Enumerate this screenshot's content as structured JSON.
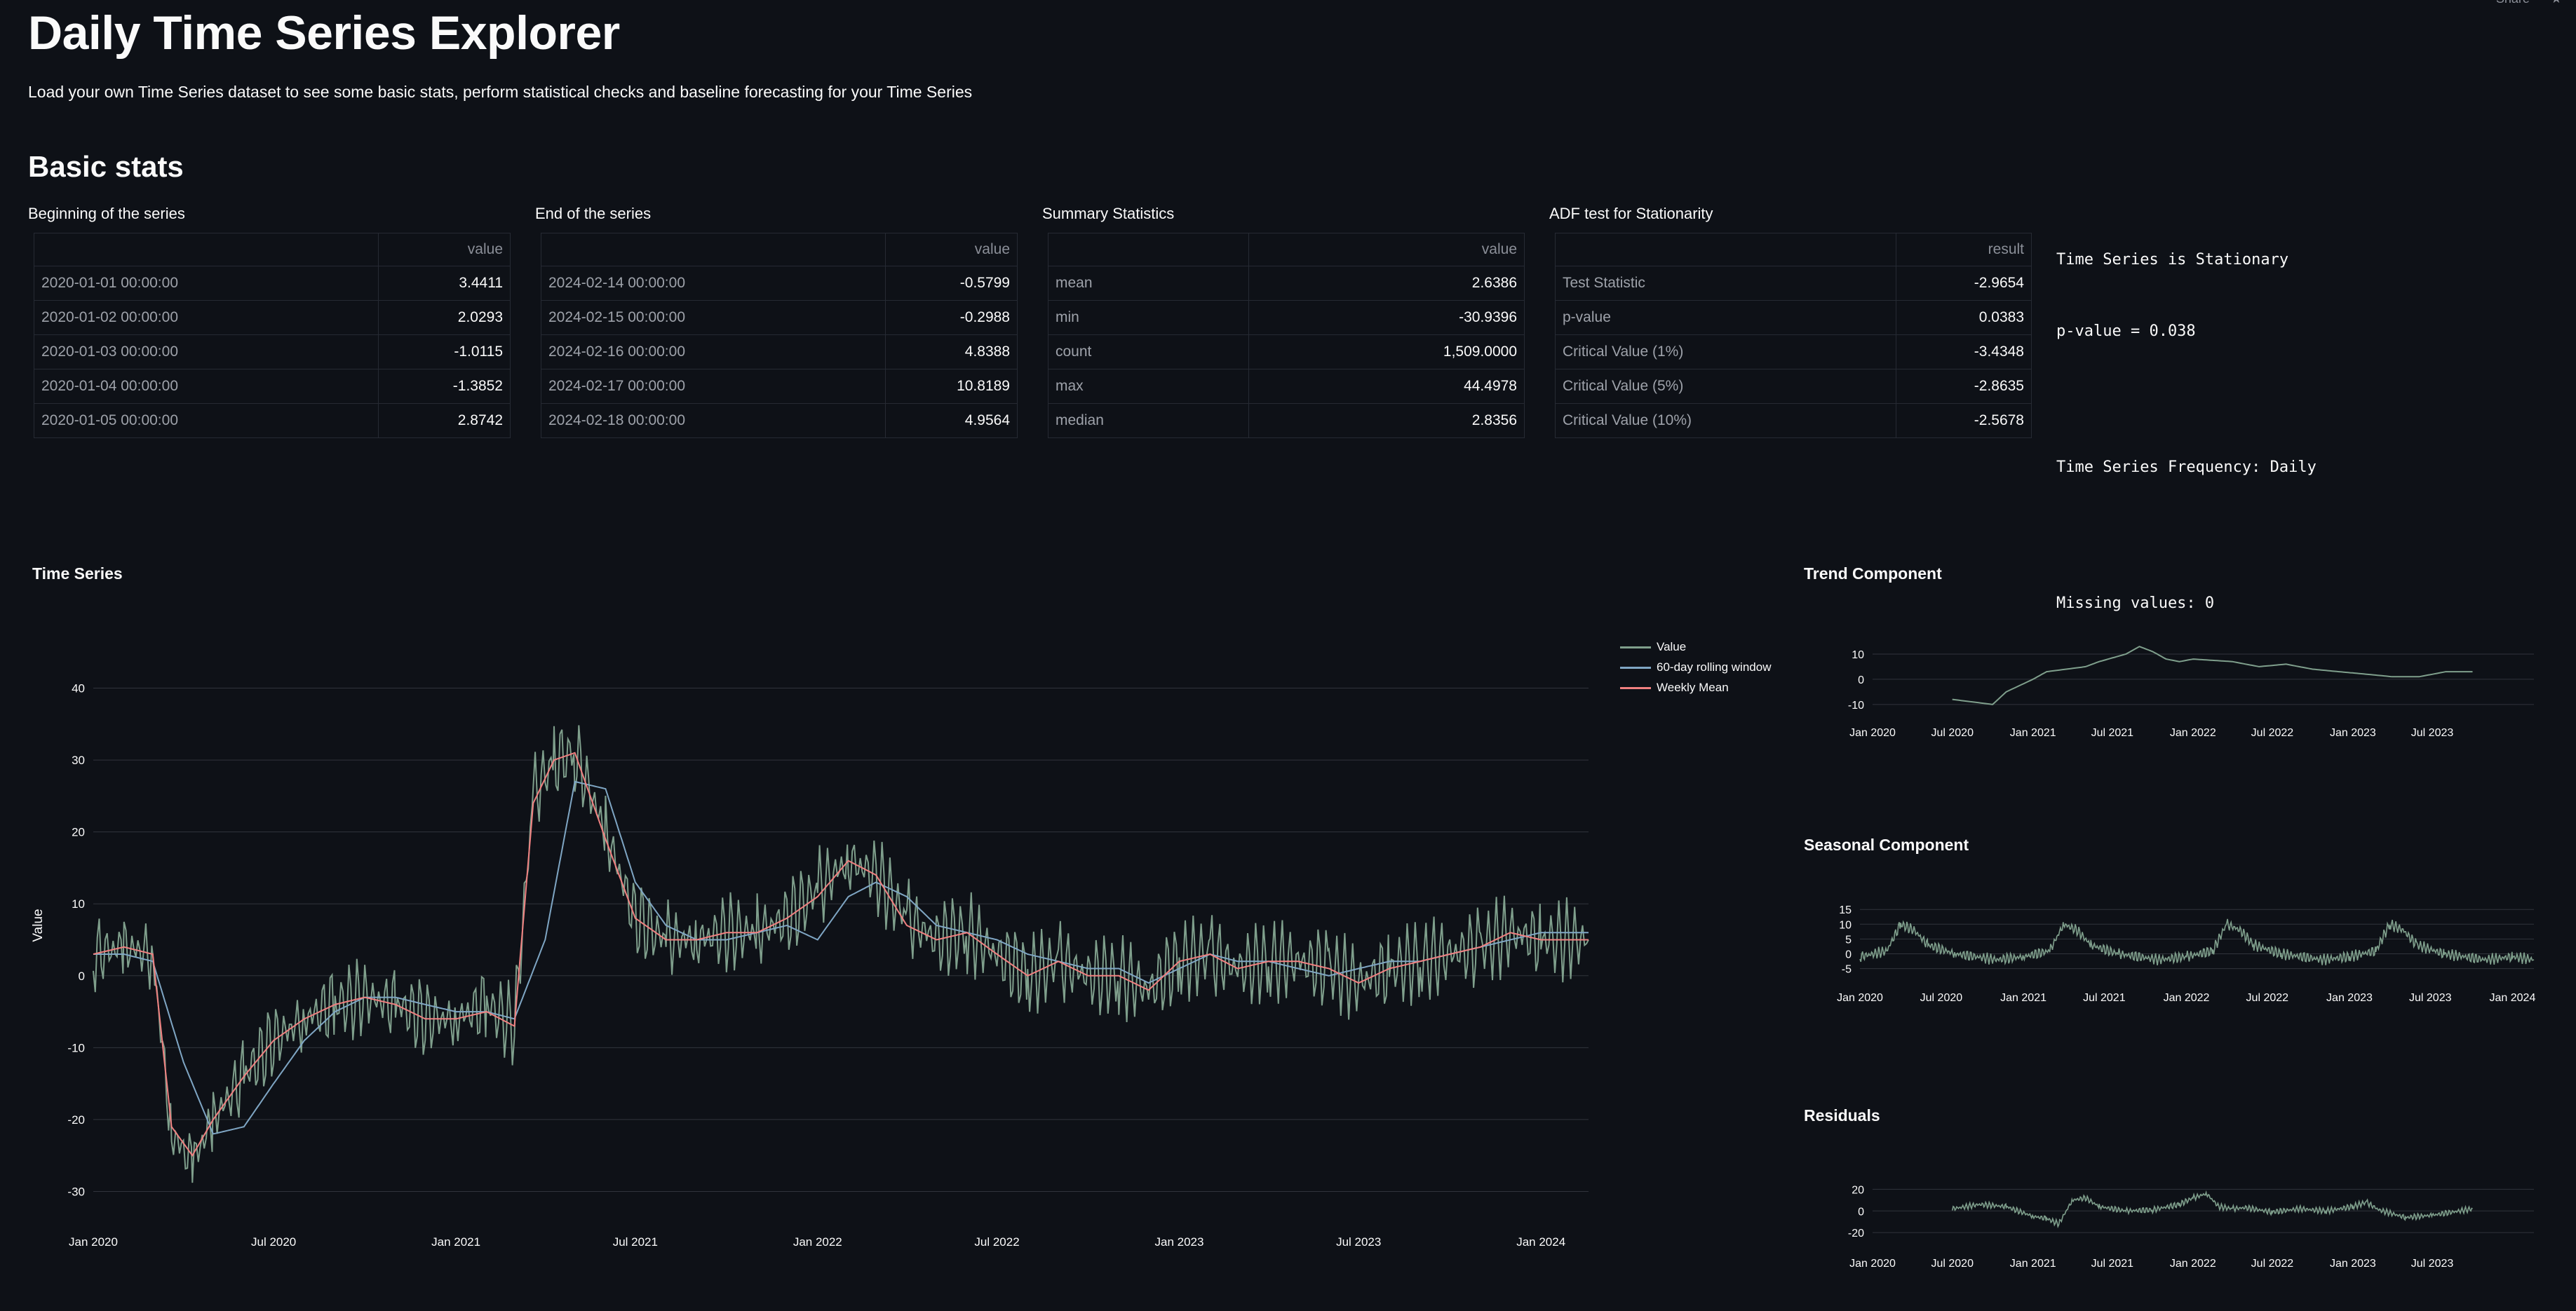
{
  "topbar": {
    "share_label": "Share",
    "star_icon": "star-icon"
  },
  "header": {
    "title": "Daily Time Series Explorer",
    "subtitle": "Load your own Time Series dataset to see some basic stats, perform statistical checks and baseline forecasting for your Time Series"
  },
  "basic_stats": {
    "heading": "Basic stats",
    "tables": [
      {
        "caption": "Beginning of the series",
        "column": "value",
        "rows": [
          [
            "2020-01-01 00:00:00",
            "3.4411"
          ],
          [
            "2020-01-02 00:00:00",
            "2.0293"
          ],
          [
            "2020-01-03 00:00:00",
            "-1.0115"
          ],
          [
            "2020-01-04 00:00:00",
            "-1.3852"
          ],
          [
            "2020-01-05 00:00:00",
            "2.8742"
          ]
        ]
      },
      {
        "caption": "End of the series",
        "column": "value",
        "rows": [
          [
            "2024-02-14 00:00:00",
            "-0.5799"
          ],
          [
            "2024-02-15 00:00:00",
            "-0.2988"
          ],
          [
            "2024-02-16 00:00:00",
            "4.8388"
          ],
          [
            "2024-02-17 00:00:00",
            "10.8189"
          ],
          [
            "2024-02-18 00:00:00",
            "4.9564"
          ]
        ]
      },
      {
        "caption": "Summary Statistics",
        "column": "value",
        "rows": [
          [
            "mean",
            "2.6386"
          ],
          [
            "min",
            "-30.9396"
          ],
          [
            "count",
            "1,509.0000"
          ],
          [
            "max",
            "44.4978"
          ],
          [
            "median",
            "2.8356"
          ]
        ]
      },
      {
        "caption": "ADF test for Stationarity",
        "column": "result",
        "rows": [
          [
            "Test Statistic",
            "-2.9654"
          ],
          [
            "p-value",
            "0.0383"
          ],
          [
            "Critical Value (1%)",
            "-3.4348"
          ],
          [
            "Critical Value (5%)",
            "-2.8635"
          ],
          [
            "Critical Value (10%)",
            "-2.5678"
          ]
        ]
      }
    ],
    "info_lines": [
      "Time Series is Stationary",
      "p-value = 0.038",
      "Time Series Frequency: Daily",
      "Missing values: 0"
    ]
  },
  "colors": {
    "background": "#0e1117",
    "value": "#7f9f8c",
    "rolling": "#7fa6c4",
    "weekly": "#f08080",
    "grid": "#31343c"
  },
  "chart_data": [
    {
      "type": "line",
      "title": "Time Series",
      "ylabel": "Value",
      "xlabel": "",
      "ylim": [
        -32,
        46
      ],
      "xlim": [
        "2020-01-01",
        "2024-02-18"
      ],
      "x_ticks": [
        "Jan 2020",
        "Jul 2020",
        "Jan 2021",
        "Jul 2021",
        "Jan 2022",
        "Jul 2022",
        "Jan 2023",
        "Jul 2023",
        "Jan 2024"
      ],
      "y_ticks": [
        -30,
        -20,
        -10,
        0,
        10,
        20,
        30,
        40
      ],
      "grid": true,
      "legend_position": "top-right",
      "series": [
        {
          "name": "Value",
          "color": "#7f9f8c",
          "x": [
            "2020-01-01",
            "2020-02-01",
            "2020-03-01",
            "2020-03-20",
            "2020-04-10",
            "2020-05-01",
            "2020-06-01",
            "2020-07-01",
            "2020-08-01",
            "2020-09-01",
            "2020-10-01",
            "2020-11-01",
            "2020-12-01",
            "2021-01-01",
            "2021-02-01",
            "2021-03-01",
            "2021-03-20",
            "2021-04-10",
            "2021-05-01",
            "2021-06-01",
            "2021-07-01",
            "2021-08-01",
            "2021-09-01",
            "2021-10-01",
            "2021-11-01",
            "2021-12-01",
            "2022-01-01",
            "2022-02-01",
            "2022-03-01",
            "2022-04-01",
            "2022-05-01",
            "2022-06-01",
            "2022-07-01",
            "2022-08-01",
            "2022-09-01",
            "2022-10-01",
            "2022-11-01",
            "2022-12-01",
            "2023-01-01",
            "2023-02-01",
            "2023-03-01",
            "2023-04-01",
            "2023-05-01",
            "2023-06-01",
            "2023-07-01",
            "2023-08-01",
            "2023-09-01",
            "2023-10-01",
            "2023-11-01",
            "2023-12-01",
            "2024-01-01",
            "2024-02-18"
          ],
          "y": [
            3,
            4,
            3,
            -22,
            -26,
            -20,
            -14,
            -9,
            -6,
            -4,
            -3,
            -4,
            -6,
            -6,
            -4,
            -7,
            25,
            30,
            31,
            20,
            8,
            5,
            5,
            6,
            6,
            8,
            12,
            16,
            14,
            8,
            5,
            6,
            3,
            0,
            2,
            0,
            0,
            -2,
            2,
            3,
            1,
            2,
            2,
            1,
            -1,
            1,
            2,
            3,
            4,
            6,
            5,
            5
          ]
        },
        {
          "name": "60-day rolling window",
          "color": "#7fa6c4",
          "x": [
            "2020-01-01",
            "2020-02-01",
            "2020-03-01",
            "2020-04-01",
            "2020-05-01",
            "2020-06-01",
            "2020-07-01",
            "2020-08-01",
            "2020-09-01",
            "2020-10-01",
            "2020-11-01",
            "2020-12-01",
            "2021-01-01",
            "2021-02-01",
            "2021-03-01",
            "2021-04-01",
            "2021-05-01",
            "2021-06-01",
            "2021-07-01",
            "2021-08-01",
            "2021-09-01",
            "2021-10-01",
            "2021-11-01",
            "2021-12-01",
            "2022-01-01",
            "2022-02-01",
            "2022-03-01",
            "2022-04-01",
            "2022-05-01",
            "2022-06-01",
            "2022-07-01",
            "2022-08-01",
            "2022-09-01",
            "2022-10-01",
            "2022-11-01",
            "2022-12-01",
            "2023-01-01",
            "2023-02-01",
            "2023-03-01",
            "2023-04-01",
            "2023-05-01",
            "2023-06-01",
            "2023-07-01",
            "2023-08-01",
            "2023-09-01",
            "2023-10-01",
            "2023-11-01",
            "2023-12-01",
            "2024-01-01",
            "2024-02-18"
          ],
          "y": [
            3,
            3,
            2,
            -12,
            -22,
            -21,
            -15,
            -9,
            -5,
            -3,
            -3,
            -4,
            -5,
            -5,
            -6,
            5,
            27,
            26,
            13,
            7,
            5,
            5,
            6,
            7,
            5,
            11,
            13,
            11,
            7,
            6,
            5,
            3,
            2,
            1,
            1,
            -1,
            1,
            3,
            2,
            2,
            1,
            0,
            1,
            2,
            2,
            3,
            4,
            5,
            6,
            6
          ]
        },
        {
          "name": "Weekly Mean",
          "color": "#f08080",
          "x": [
            "2020-01-01",
            "2020-02-01",
            "2020-03-01",
            "2020-03-20",
            "2020-04-10",
            "2020-05-01",
            "2020-06-01",
            "2020-07-01",
            "2020-08-01",
            "2020-09-01",
            "2020-10-01",
            "2020-11-01",
            "2020-12-01",
            "2021-01-01",
            "2021-02-01",
            "2021-03-01",
            "2021-03-20",
            "2021-04-10",
            "2021-05-01",
            "2021-06-01",
            "2021-07-01",
            "2021-08-01",
            "2021-09-01",
            "2021-10-01",
            "2021-11-01",
            "2021-12-01",
            "2022-01-01",
            "2022-02-01",
            "2022-03-01",
            "2022-04-01",
            "2022-05-01",
            "2022-06-01",
            "2022-07-01",
            "2022-08-01",
            "2022-09-01",
            "2022-10-01",
            "2022-11-01",
            "2022-12-01",
            "2023-01-01",
            "2023-02-01",
            "2023-03-01",
            "2023-04-01",
            "2023-05-01",
            "2023-06-01",
            "2023-07-01",
            "2023-08-01",
            "2023-09-01",
            "2023-10-01",
            "2023-11-01",
            "2023-12-01",
            "2024-01-01",
            "2024-02-18"
          ],
          "y": [
            3,
            4,
            3,
            -21,
            -25,
            -20,
            -14,
            -9,
            -6,
            -4,
            -3,
            -4,
            -6,
            -6,
            -5,
            -7,
            24,
            30,
            31,
            19,
            8,
            5,
            5,
            6,
            6,
            8,
            11,
            16,
            14,
            7,
            5,
            6,
            3,
            0,
            2,
            0,
            0,
            -2,
            2,
            3,
            1,
            2,
            2,
            1,
            -1,
            1,
            2,
            3,
            4,
            6,
            5,
            5
          ]
        }
      ]
    },
    {
      "type": "line",
      "title": "Trend Component",
      "ylim": [
        -12,
        15
      ],
      "xlim": [
        "2020-01-01",
        "2024-02-18"
      ],
      "x_ticks": [
        "Jan 2020",
        "Jul 2020",
        "Jan 2021",
        "Jul 2021",
        "Jan 2022",
        "Jul 2022",
        "Jan 2023",
        "Jul 2023"
      ],
      "y_ticks": [
        -10,
        0,
        10
      ],
      "grid": true,
      "series": [
        {
          "name": "",
          "color": "#7f9f8c",
          "x": [
            "2020-07-01",
            "2020-10-01",
            "2020-11-01",
            "2021-01-01",
            "2021-02-01",
            "2021-05-01",
            "2021-06-01",
            "2021-08-01",
            "2021-09-01",
            "2021-10-01",
            "2021-11-01",
            "2021-12-01",
            "2022-01-01",
            "2022-04-01",
            "2022-06-01",
            "2022-08-01",
            "2022-10-01",
            "2022-12-01",
            "2023-02-01",
            "2023-04-01",
            "2023-06-01",
            "2023-08-01",
            "2023-10-01"
          ],
          "y": [
            -8,
            -10,
            -5,
            0,
            3,
            5,
            7,
            10,
            13,
            11,
            8,
            7,
            8,
            7,
            5,
            6,
            4,
            3,
            2,
            1,
            1,
            3,
            3
          ]
        }
      ]
    },
    {
      "type": "line",
      "title": "Seasonal Component",
      "ylim": [
        -7,
        16
      ],
      "xlim": [
        "2020-01-01",
        "2024-02-18"
      ],
      "x_ticks": [
        "Jan 2020",
        "Jul 2020",
        "Jan 2021",
        "Jul 2021",
        "Jan 2022",
        "Jul 2022",
        "Jan 2023",
        "Jul 2023",
        "Jan 2024"
      ],
      "y_ticks": [
        -5,
        0,
        5,
        10,
        15
      ],
      "grid": true,
      "series": [
        {
          "name": "",
          "color": "#7f9f8c",
          "period_days": 365,
          "x": [
            "2020-01-01",
            "2020-03-01",
            "2020-04-01",
            "2020-05-01",
            "2020-06-01",
            "2020-08-01",
            "2020-11-01",
            "2021-01-01",
            "2021-03-01",
            "2021-04-01",
            "2021-05-01",
            "2021-06-01",
            "2021-08-01",
            "2021-11-01",
            "2022-01-01",
            "2022-03-01",
            "2022-04-01",
            "2022-05-01",
            "2022-06-01",
            "2022-08-01",
            "2022-11-01",
            "2023-01-01",
            "2023-03-01",
            "2023-04-01",
            "2023-05-01",
            "2023-06-01",
            "2023-08-01",
            "2023-11-01",
            "2024-01-01",
            "2024-02-18"
          ],
          "y": [
            -1,
            1,
            10,
            8,
            3,
            0,
            -2,
            -1,
            1,
            10,
            8,
            3,
            0,
            -2,
            -1,
            1,
            10,
            8,
            3,
            0,
            -2,
            -1,
            1,
            10,
            8,
            3,
            0,
            -2,
            -1,
            -2
          ]
        }
      ]
    },
    {
      "type": "line",
      "title": "Residuals",
      "ylim": [
        -27,
        28
      ],
      "xlim": [
        "2020-01-01",
        "2024-02-18"
      ],
      "x_ticks": [
        "Jan 2020",
        "Jul 2020",
        "Jan 2021",
        "Jul 2021",
        "Jan 2022",
        "Jul 2022",
        "Jan 2023",
        "Jul 2023"
      ],
      "y_ticks": [
        -20,
        0,
        20
      ],
      "grid": true,
      "series": [
        {
          "name": "",
          "color": "#7f9f8c",
          "x": [
            "2020-07-01",
            "2020-09-01",
            "2020-11-01",
            "2021-01-01",
            "2021-02-01",
            "2021-03-01",
            "2021-04-01",
            "2021-05-01",
            "2021-06-01",
            "2021-08-01",
            "2021-10-01",
            "2021-12-01",
            "2022-01-01",
            "2022-02-01",
            "2022-03-01",
            "2022-04-01",
            "2022-05-01",
            "2022-07-01",
            "2022-09-01",
            "2022-11-01",
            "2023-01-01",
            "2023-02-01",
            "2023-03-01",
            "2023-05-01",
            "2023-07-01",
            "2023-09-01",
            "2023-10-01"
          ],
          "y": [
            2,
            6,
            4,
            -5,
            -7,
            -12,
            10,
            12,
            4,
            0,
            1,
            6,
            12,
            16,
            4,
            2,
            3,
            -1,
            2,
            0,
            4,
            8,
            1,
            -6,
            -4,
            0,
            2
          ]
        }
      ]
    }
  ]
}
